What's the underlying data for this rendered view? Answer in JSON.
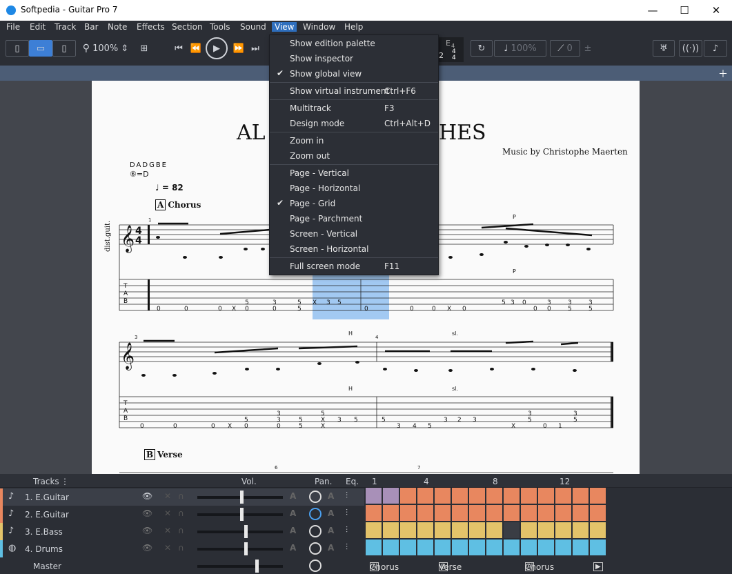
{
  "window": {
    "title": "Softpedia - Guitar Pro 7",
    "min": "—",
    "max": "☐",
    "close": "✕"
  },
  "menubar": [
    "File",
    "Edit",
    "Track",
    "Bar",
    "Note",
    "Effects",
    "Section",
    "Tools",
    "Sound",
    "View",
    "Window",
    "Help"
  ],
  "toolbar": {
    "zoom": "100%",
    "tempo_pct": "100%",
    "capo": "0",
    "time_sig_top": "4",
    "time_sig_bottom": "4",
    "note_name": "E",
    "note_octave": "4",
    "count": "2"
  },
  "score": {
    "title_left": "AL",
    "title_right": "CHES",
    "composer": "Music by Christophe Maerten",
    "tuning": "DADGBE",
    "tuning_note": "⑥=D",
    "tempo": "♩ = 82",
    "track_label": "dist.guit.",
    "section_a_box": "A",
    "section_a": "Chorus",
    "section_b_box": "B",
    "section_b": "Verse",
    "bar_numbers": [
      "1",
      "3",
      "4",
      "6",
      "7"
    ],
    "marks": [
      "P",
      "P",
      "H",
      "H",
      "sl.",
      "sl."
    ]
  },
  "view_menu": {
    "items": [
      {
        "label": "Show edition palette",
        "shortcut": "",
        "checked": false
      },
      {
        "label": "Show inspector",
        "shortcut": "",
        "checked": false
      },
      {
        "label": "Show global view",
        "shortcut": "",
        "checked": true
      },
      {
        "label": "Show virtual instrument",
        "shortcut": "Ctrl+F6",
        "checked": false
      },
      {
        "label": "Multitrack",
        "shortcut": "F3",
        "checked": false
      },
      {
        "label": "Design mode",
        "shortcut": "Ctrl+Alt+D",
        "checked": false
      },
      {
        "label": "Zoom in",
        "shortcut": "",
        "checked": false
      },
      {
        "label": "Zoom out",
        "shortcut": "",
        "checked": false
      },
      {
        "label": "Page - Vertical",
        "shortcut": "",
        "checked": false
      },
      {
        "label": "Page - Horizontal",
        "shortcut": "",
        "checked": false
      },
      {
        "label": "Page - Grid",
        "shortcut": "",
        "checked": true
      },
      {
        "label": "Page - Parchment",
        "shortcut": "",
        "checked": false
      },
      {
        "label": "Screen - Vertical",
        "shortcut": "",
        "checked": false
      },
      {
        "label": "Screen - Horizontal",
        "shortcut": "",
        "checked": false
      },
      {
        "label": "Full screen mode",
        "shortcut": "F11",
        "checked": false
      }
    ],
    "check_glyph": "✔"
  },
  "tracks_panel": {
    "header": {
      "tracks": "Tracks",
      "vol": "Vol.",
      "pan": "Pan.",
      "eq": "Eq.",
      "bar_1": "1",
      "bar_4": "4",
      "bar_8": "8",
      "bar_12": "12"
    },
    "tracks": [
      {
        "name": "1. E.Guitar",
        "color": "#e8875f",
        "volume": 0.52
      },
      {
        "name": "2. E.Guitar",
        "color": "#e8875f",
        "volume": 0.52
      },
      {
        "name": "3. E.Bass",
        "color": "#e3c36a",
        "volume": 0.57
      },
      {
        "name": "4. Drums",
        "color": "#5fbfe3",
        "volume": 0.57
      }
    ],
    "master": "Master",
    "master_volume": 0.7,
    "sections": [
      {
        "box": "A",
        "label": "Chorus"
      },
      {
        "box": "B",
        "label": "Verse"
      },
      {
        "box": "A",
        "label": "Chorus"
      }
    ]
  },
  "colors": {
    "guitar": "#e8875f",
    "bass": "#e3c36a",
    "drums": "#5fbfe3",
    "selected": "#a890b8",
    "accent": "#3d7fd6"
  }
}
